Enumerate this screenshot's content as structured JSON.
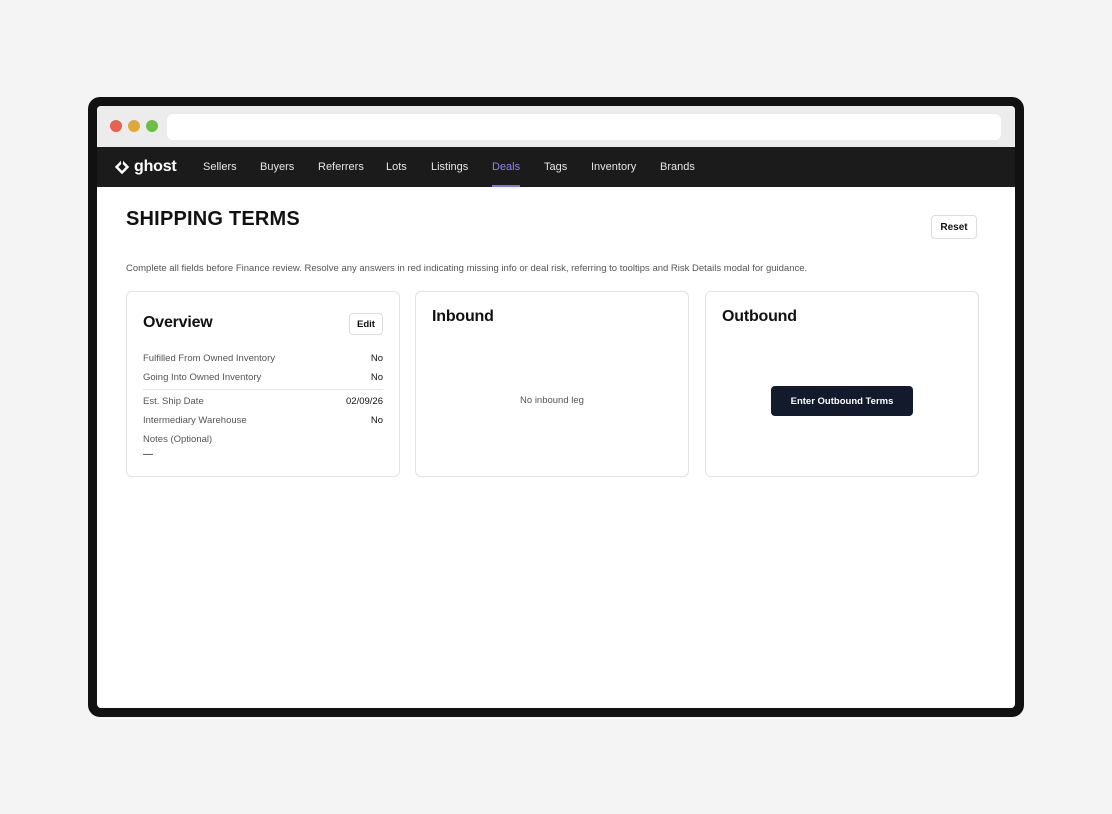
{
  "app": {
    "logo_text": "ghost"
  },
  "nav": {
    "items": [
      "Sellers",
      "Buyers",
      "Referrers",
      "Lots",
      "Listings",
      "Deals",
      "Tags",
      "Inventory",
      "Brands"
    ],
    "active": "Deals"
  },
  "page": {
    "title": "SHIPPING TERMS",
    "reset_label": "Reset",
    "instructions": "Complete all fields before Finance review. Resolve any answers in red indicating missing info or deal risk, referring to tooltips and Risk Details modal for guidance."
  },
  "overview": {
    "title": "Overview",
    "edit_label": "Edit",
    "rows": [
      {
        "label": "Fulfilled From Owned Inventory",
        "value": "No"
      },
      {
        "label": "Going Into Owned Inventory",
        "value": "No"
      },
      {
        "label": "Est. Ship Date",
        "value": "02/09/26"
      },
      {
        "label": "Intermediary Warehouse",
        "value": "No"
      }
    ],
    "notes_label": "Notes (Optional)",
    "notes_value": "—"
  },
  "inbound": {
    "title": "Inbound",
    "empty_message": "No inbound leg"
  },
  "outbound": {
    "title": "Outbound",
    "button_label": "Enter Outbound Terms"
  },
  "colors": {
    "nav_bg": "#1b1b1b",
    "nav_active": "#8b86ee",
    "primary_button": "#121a2b"
  }
}
